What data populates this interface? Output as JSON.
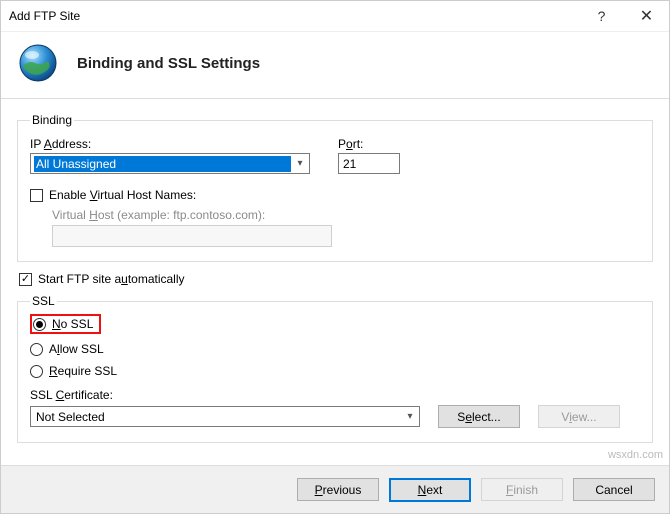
{
  "window": {
    "title": "Add FTP Site",
    "heading": "Binding and SSL Settings"
  },
  "binding": {
    "legend": "Binding",
    "ip_label_pre": "IP ",
    "ip_label_u": "A",
    "ip_label_post": "ddress:",
    "ip_value": "All Unassigned",
    "port_label_pre": "P",
    "port_label_u": "o",
    "port_label_post": "rt:",
    "port_value": "21",
    "enable_vhost_pre": "Enable ",
    "enable_vhost_u": "V",
    "enable_vhost_post": "irtual Host Names:",
    "vhost_label_pre": "Virtual ",
    "vhost_label_u": "H",
    "vhost_label_post": "ost (example: ftp.contoso.com):"
  },
  "autostart": {
    "pre": "Start FTP site a",
    "u": "u",
    "post": "tomatically",
    "checked": true
  },
  "ssl": {
    "legend": "SSL",
    "no_pre": "",
    "no_u": "N",
    "no_post": "o SSL",
    "allow_pre": "A",
    "allow_u": "l",
    "allow_post": "low SSL",
    "require_pre": "",
    "require_u": "R",
    "require_post": "equire SSL",
    "cert_label_pre": "SSL ",
    "cert_label_u": "C",
    "cert_label_post": "ertificate:",
    "cert_value": "Not Selected",
    "select_btn_pre": "S",
    "select_btn_u": "e",
    "select_btn_post": "lect...",
    "view_btn_pre": "V",
    "view_btn_u": "i",
    "view_btn_post": "ew..."
  },
  "footer": {
    "prev_pre": "",
    "prev_u": "P",
    "prev_post": "revious",
    "next_pre": "",
    "next_u": "N",
    "next_post": "ext",
    "finish_pre": "",
    "finish_u": "F",
    "finish_post": "inish",
    "cancel": "Cancel"
  },
  "watermark": "wsxdn.com"
}
